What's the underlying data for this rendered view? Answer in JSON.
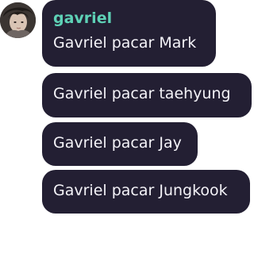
{
  "chat": {
    "sender": {
      "name": "gavriel",
      "name_color": "#5ed1b6"
    },
    "messages": [
      {
        "text": "Gavriel pacar Mark"
      },
      {
        "text": "Gavriel pacar taehyung"
      },
      {
        "text": "Gavriel pacar Jay"
      },
      {
        "text": "Gavriel pacar Jungkook"
      }
    ],
    "bubble_color": "#231f33",
    "text_color": "#f4f3f8"
  }
}
